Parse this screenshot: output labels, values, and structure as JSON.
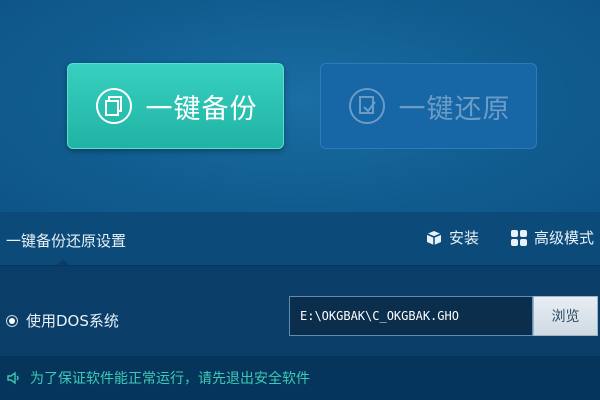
{
  "actions": {
    "backup": {
      "label": "一键备份",
      "icon": "copy-icon",
      "color": "#2cc4b4"
    },
    "restore": {
      "label": "一键还原",
      "icon": "restore-icon",
      "state": "disabled"
    }
  },
  "settings": {
    "title": "一键备份还原设置",
    "install": {
      "label": "安装",
      "icon": "box-icon"
    },
    "advanced": {
      "label": "高级模式",
      "icon": "grid-icon"
    }
  },
  "option": {
    "use_dos_label": "使用DOS系统",
    "use_dos_checked": true,
    "path_value": "E:\\OKGBAK\\C_OKGBAK.GHO",
    "browse_label": "浏览"
  },
  "warning": {
    "icon": "speaker-icon",
    "text": "为了保证软件能正常运行，请先退出安全软件",
    "color": "#3ccab6"
  }
}
